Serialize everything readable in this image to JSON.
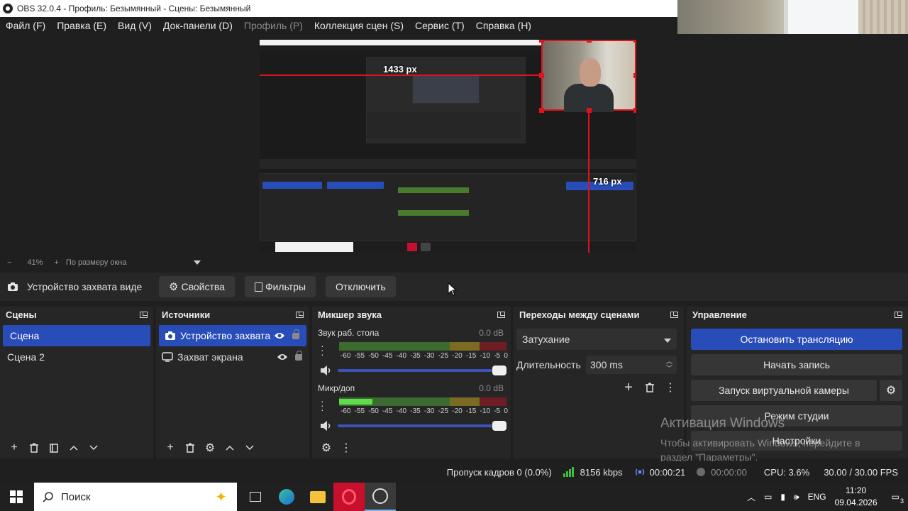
{
  "window": {
    "title": "OBS 32.0.4 - Профиль: Безымянный - Сцены: Безымянный"
  },
  "menu": [
    {
      "label": "Файл (F)",
      "disabled": false
    },
    {
      "label": "Правка (E)",
      "disabled": false
    },
    {
      "label": "Вид (V)",
      "disabled": false
    },
    {
      "label": "Док-панели (D)",
      "disabled": false
    },
    {
      "label": "Профиль (P)",
      "disabled": true
    },
    {
      "label": "Коллекция сцен (S)",
      "disabled": false
    },
    {
      "label": "Сервис (T)",
      "disabled": false
    },
    {
      "label": "Справка (H)",
      "disabled": false
    }
  ],
  "preview": {
    "label_h": "1433 px",
    "label_v": "716 px"
  },
  "zoom": {
    "minus": "−",
    "value": "41%",
    "plus": "+",
    "fit": "По размеру окна"
  },
  "source_toolbar": {
    "source_name": "Устройство захвата виде",
    "properties": "Свойства",
    "filters": "Фильтры",
    "deactivate": "Отключить"
  },
  "scenes": {
    "title": "Сцены",
    "items": [
      "Сцена",
      "Сцена 2"
    ]
  },
  "sources": {
    "title": "Источники",
    "items": [
      {
        "label": "Устройство захвата виде",
        "icon": "camera-icon"
      },
      {
        "label": "Захват экрана",
        "icon": "monitor-icon"
      }
    ]
  },
  "mixer": {
    "title": "Микшер звука",
    "channels": [
      {
        "name": "Звук раб. стола",
        "db": "0.0 dB",
        "level": 0.0
      },
      {
        "name": "Микр/доп",
        "db": "0.0 dB",
        "level": 0.2
      }
    ],
    "scale": [
      "-60",
      "-55",
      "-50",
      "-45",
      "-40",
      "-35",
      "-30",
      "-25",
      "-20",
      "-15",
      "-10",
      "-5",
      "0"
    ]
  },
  "transitions": {
    "title": "Переходы между сценами",
    "type": "Затухание",
    "duration_label": "Длительность",
    "duration_value": "300 ms"
  },
  "controls": {
    "title": "Управление",
    "stop_stream": "Остановить трансляцию",
    "start_record": "Начать запись",
    "virtual_cam": "Запуск виртуальной камеры",
    "studio_mode": "Режим студии",
    "settings": "Настройки"
  },
  "status": {
    "dropped": "Пропуск кадров 0 (0.0%)",
    "kbps": "8156 kbps",
    "stream_time": "00:00:21",
    "rec_time": "00:00:00",
    "cpu": "CPU: 3.6%",
    "fps": "30.00 / 30.00 FPS"
  },
  "watermark": {
    "line1": "Активация Windows",
    "line2": "Чтобы активировать Windows, перейдите в",
    "line3": "раздел \"Параметры\"."
  },
  "taskbar": {
    "search": "Поиск",
    "lang": "ENG",
    "time": "11:20",
    "date": "09.04.2026",
    "notifications": "3"
  },
  "colors": {
    "accent": "#284cb8",
    "guide": "#e0121c",
    "panel": "#262626"
  }
}
